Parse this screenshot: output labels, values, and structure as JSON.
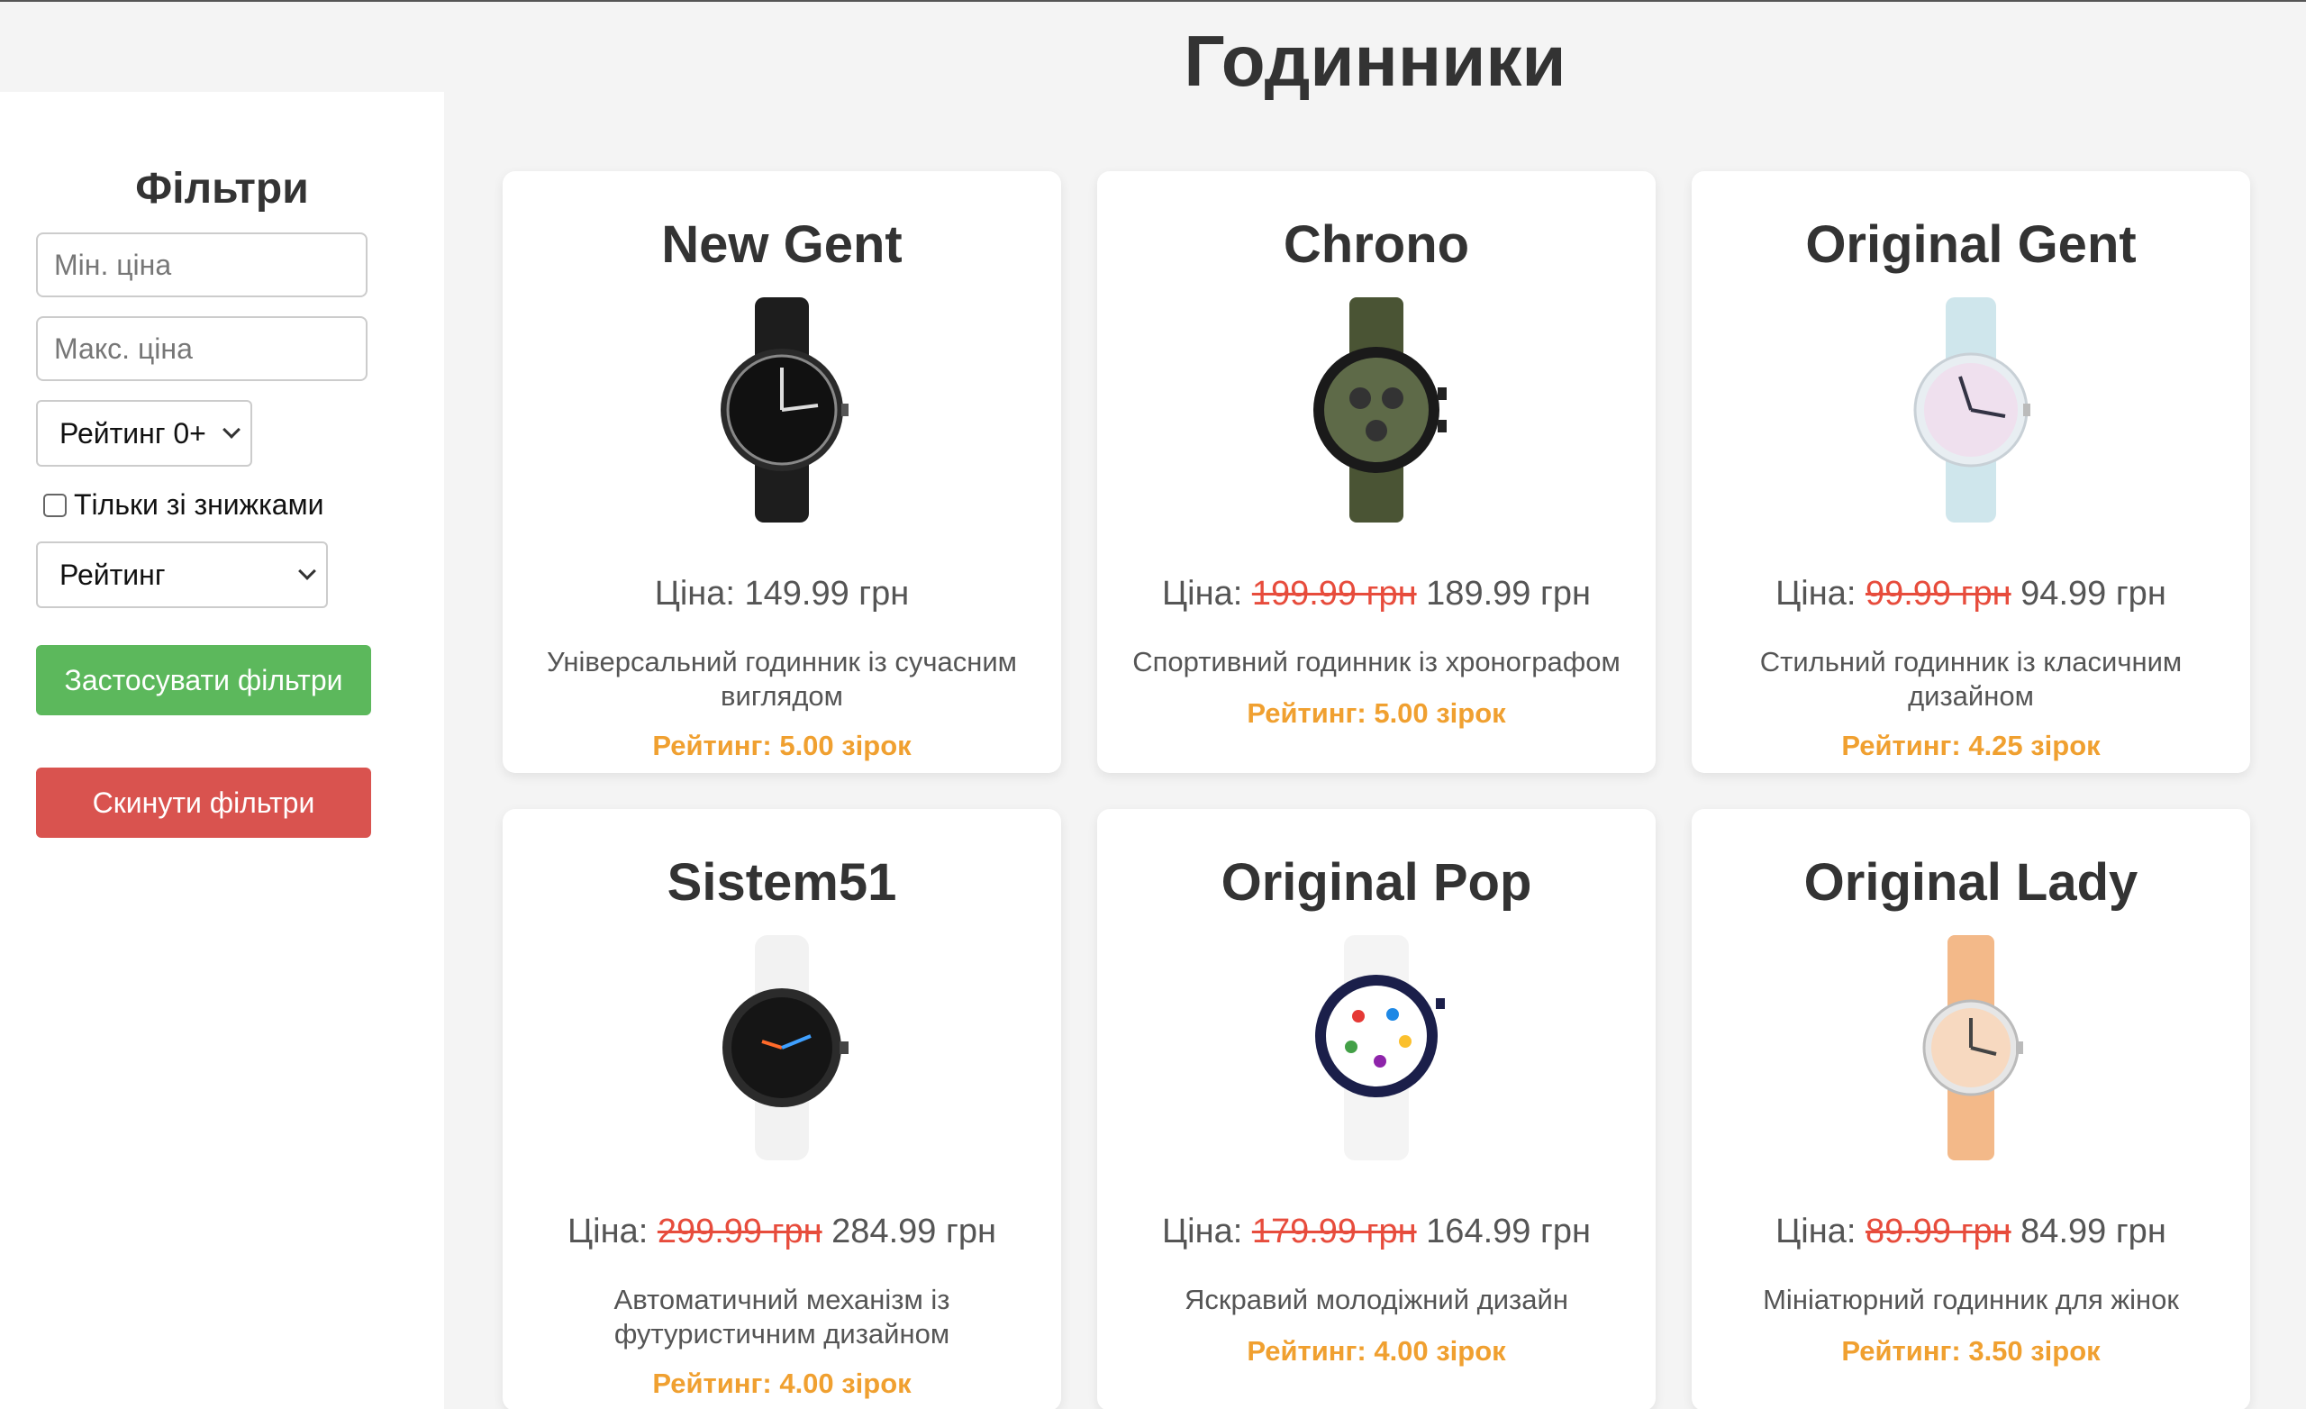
{
  "page": {
    "title": "Годинники"
  },
  "filters": {
    "title": "Фільтри",
    "min_price_placeholder": "Мін. ціна",
    "max_price_placeholder": "Макс. ціна",
    "rating_select_value": "Рейтинг 0+",
    "discount_label": "Тільки зі знижками",
    "sort_select_value": "Рейтинг",
    "apply_label": "Застосувати фільтри",
    "reset_label": "Скинути фільтри",
    "apply_color": "#5cb85c",
    "reset_color": "#d9534f"
  },
  "price_prefix": "Ціна:",
  "products": [
    {
      "name": "New Gent",
      "old_price": "",
      "price": "149.99 грн",
      "description": "Універсальний годинник із сучасним виглядом",
      "rating": "Рейтинг: 5.00 зірок",
      "image": "black-watch-icon"
    },
    {
      "name": "Chrono",
      "old_price": "199.99 грн",
      "price": "189.99 грн",
      "description": "Спортивний годинник із хронографом",
      "rating": "Рейтинг: 5.00 зірок",
      "image": "green-chrono-watch-icon"
    },
    {
      "name": "Original Gent",
      "old_price": "99.99 грн",
      "price": "94.99 грн",
      "description": "Стильний годинник із класичним дизайном",
      "rating": "Рейтинг: 4.25 зірок",
      "image": "light-blue-watch-icon"
    },
    {
      "name": "Sistem51",
      "old_price": "299.99 грн",
      "price": "284.99 грн",
      "description": "Автоматичний механізм із футуристичним дизайном",
      "rating": "Рейтинг: 4.00 зірок",
      "image": "white-black-dial-watch-icon"
    },
    {
      "name": "Original Pop",
      "old_price": "179.99 грн",
      "price": "164.99 грн",
      "description": "Яскравий молодіжний дизайн",
      "rating": "Рейтинг: 4.00 зірок",
      "image": "colorful-pop-watch-icon"
    },
    {
      "name": "Original Lady",
      "old_price": "89.99 грн",
      "price": "84.99 грн",
      "description": "Мініатюрний годинник для жінок",
      "rating": "Рейтинг: 3.50 зірок",
      "image": "peach-lady-watch-icon"
    }
  ],
  "colors": {
    "rating": "#f0a030",
    "old_price": "#e74c3c"
  }
}
